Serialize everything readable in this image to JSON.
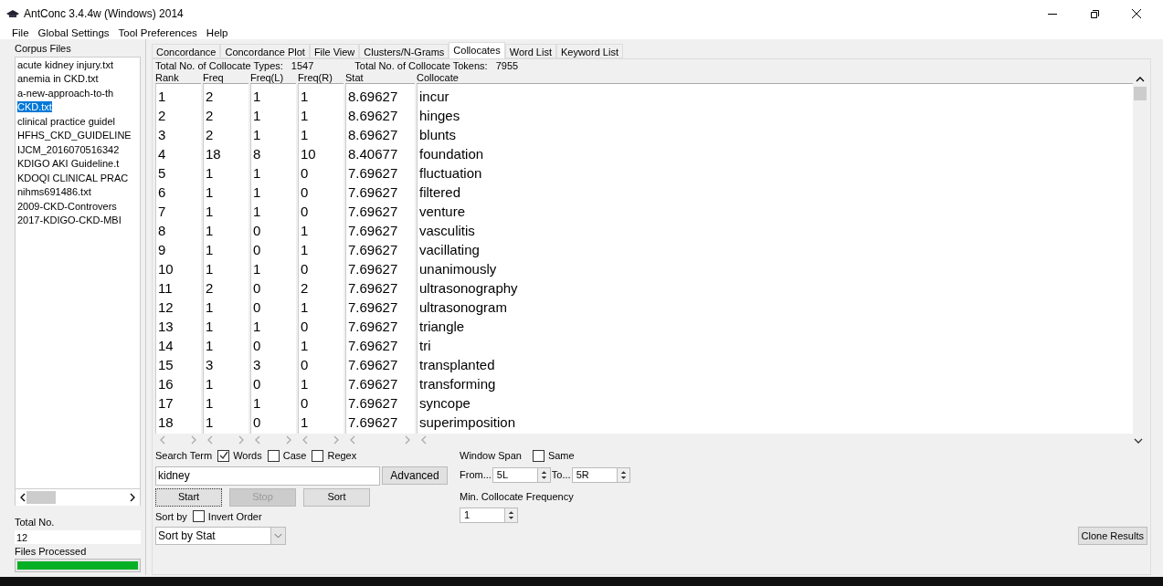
{
  "window": {
    "title": "AntConc 3.4.4w (Windows) 2014"
  },
  "menu": [
    "File",
    "Global Settings",
    "Tool Preferences",
    "Help"
  ],
  "corpus_files": {
    "label": "Corpus Files",
    "items": [
      {
        "name": "acute kidney injury.txt",
        "selected": false
      },
      {
        "name": "anemia in CKD.txt",
        "selected": false
      },
      {
        "name": "a-new-approach-to-th",
        "selected": false
      },
      {
        "name": "CKD.txt",
        "selected": true
      },
      {
        "name": "clinical practice guidel",
        "selected": false
      },
      {
        "name": "HFHS_CKD_GUIDELINE",
        "selected": false
      },
      {
        "name": "IJCM_2016070516342",
        "selected": false
      },
      {
        "name": "KDIGO AKI Guideline.t",
        "selected": false
      },
      {
        "name": "KDOQI CLINICAL PRAC",
        "selected": false
      },
      {
        "name": "nihms691486.txt",
        "selected": false
      },
      {
        "name": "2009-CKD-Controvers",
        "selected": false
      },
      {
        "name": "2017-KDIGO-CKD-MBI",
        "selected": false
      }
    ]
  },
  "total": {
    "label": "Total No.",
    "value": "12"
  },
  "files_processed": {
    "label": "Files Processed",
    "level": 1
  },
  "tabs": [
    {
      "label": "Concordance",
      "selected": false
    },
    {
      "label": "Concordance Plot",
      "selected": false
    },
    {
      "label": "File View",
      "selected": false
    },
    {
      "label": "Clusters/N-Grams",
      "selected": false
    },
    {
      "label": "Collocates",
      "selected": true
    },
    {
      "label": "Word List",
      "selected": false
    },
    {
      "label": "Keyword List",
      "selected": false
    }
  ],
  "summary": [
    {
      "label": "Total No. of Collocate Types:",
      "value": "1547"
    },
    {
      "label": "Total No. of Collocate Tokens:",
      "value": "7955"
    }
  ],
  "table": {
    "columns": [
      "Rank",
      "Freq",
      "Freq(L)",
      "Freq(R)",
      "Stat",
      "Collocate"
    ],
    "rows": [
      [
        "1",
        "2",
        "1",
        "1",
        "8.69627",
        "incur"
      ],
      [
        "2",
        "2",
        "1",
        "1",
        "8.69627",
        "hinges"
      ],
      [
        "3",
        "2",
        "1",
        "1",
        "8.69627",
        "blunts"
      ],
      [
        "4",
        "18",
        "8",
        "10",
        "8.40677",
        "foundation"
      ],
      [
        "5",
        "1",
        "1",
        "0",
        "7.69627",
        "fluctuation"
      ],
      [
        "6",
        "1",
        "1",
        "0",
        "7.69627",
        "filtered"
      ],
      [
        "7",
        "1",
        "1",
        "0",
        "7.69627",
        "venture"
      ],
      [
        "8",
        "1",
        "0",
        "1",
        "7.69627",
        "vasculitis"
      ],
      [
        "9",
        "1",
        "0",
        "1",
        "7.69627",
        "vacillating"
      ],
      [
        "10",
        "1",
        "1",
        "0",
        "7.69627",
        "unanimously"
      ],
      [
        "11",
        "2",
        "0",
        "2",
        "7.69627",
        "ultrasonography"
      ],
      [
        "12",
        "1",
        "0",
        "1",
        "7.69627",
        "ultrasonogram"
      ],
      [
        "13",
        "1",
        "1",
        "0",
        "7.69627",
        "triangle"
      ],
      [
        "14",
        "1",
        "0",
        "1",
        "7.69627",
        "tri"
      ],
      [
        "15",
        "3",
        "3",
        "0",
        "7.69627",
        "transplanted"
      ],
      [
        "16",
        "1",
        "0",
        "1",
        "7.69627",
        "transforming"
      ],
      [
        "17",
        "1",
        "1",
        "0",
        "7.69627",
        "syncope"
      ],
      [
        "18",
        "1",
        "0",
        "1",
        "7.69627",
        "superimposition"
      ]
    ]
  },
  "search": {
    "label": "Search Term",
    "options": [
      {
        "label": "Words",
        "checked": true
      },
      {
        "label": "Case",
        "checked": false
      },
      {
        "label": "Regex",
        "checked": false
      }
    ],
    "value": "kidney",
    "advanced": "Advanced"
  },
  "buttons": [
    {
      "label": "Start",
      "disabled": false
    },
    {
      "label": "Stop",
      "disabled": true
    },
    {
      "label": "Sort",
      "disabled": false
    }
  ],
  "sort": {
    "label": "Sort by",
    "invert": {
      "label": "Invert Order",
      "checked": false
    },
    "value": "Sort by Stat"
  },
  "window_span": {
    "label": "Window Span",
    "same": {
      "label": "Same",
      "checked": false
    },
    "from_label": "From...",
    "from": "5L",
    "to_label": "To...",
    "to": "5R"
  },
  "min_freq": {
    "label": "Min. Collocate Frequency",
    "value": "1"
  },
  "clone": "Clone Results"
}
